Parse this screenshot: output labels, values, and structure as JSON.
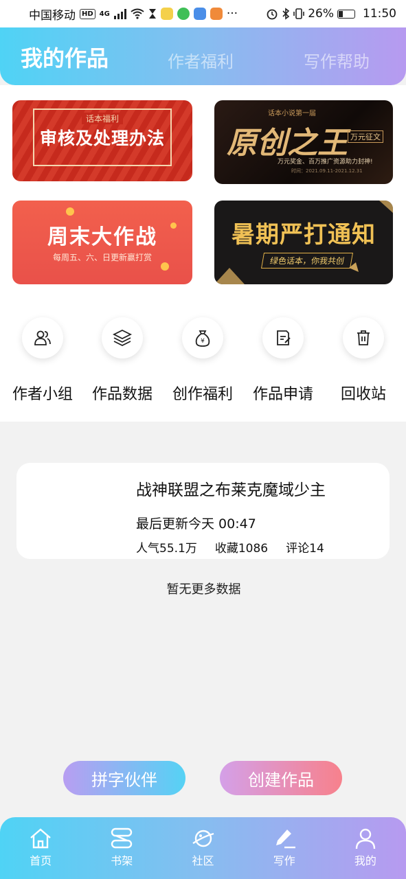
{
  "status_bar": {
    "carrier": "中国移动",
    "hd": "HD",
    "net": "4G",
    "battery": "26%",
    "time": "11:50",
    "more": "···"
  },
  "header": {
    "tabs": [
      {
        "label": "我的作品",
        "active": true
      },
      {
        "label": "作者福利",
        "active": false
      },
      {
        "label": "写作帮助",
        "active": false
      }
    ]
  },
  "banners": [
    {
      "small": "话本福利",
      "big": "审核及处理办法"
    },
    {
      "small": "话本小说第一届",
      "big": "原创之王",
      "tag": "万元征文",
      "sub": "万元奖金、百万推广资源助力封神!",
      "date": "时间：2021.09.11-2021.12.31"
    },
    {
      "big": "周末大作战",
      "sub": "每周五、六、日更新赢打赏"
    },
    {
      "big": "暑期严打通知",
      "sub": "绿色话本，你我共创"
    }
  ],
  "quick_actions": [
    {
      "label": "作者小组",
      "icon": "users-icon"
    },
    {
      "label": "作品数据",
      "icon": "layers-icon"
    },
    {
      "label": "创作福利",
      "icon": "money-bag-icon"
    },
    {
      "label": "作品申请",
      "icon": "document-edit-icon"
    },
    {
      "label": "回收站",
      "icon": "trash-icon"
    }
  ],
  "work": {
    "title": "战神联盟之布莱克魔域少主",
    "updated": "最后更新今天 00:47",
    "popularity": "人气55.1万",
    "favorites": "收藏1086",
    "comments": "评论14"
  },
  "no_more": "暂无更多数据",
  "actions": {
    "partner": "拼字伙伴",
    "create": "创建作品"
  },
  "bottom_nav": [
    {
      "label": "首页",
      "icon": "home-icon"
    },
    {
      "label": "书架",
      "icon": "bookshelf-icon"
    },
    {
      "label": "社区",
      "icon": "planet-icon"
    },
    {
      "label": "写作",
      "icon": "pen-icon"
    },
    {
      "label": "我的",
      "icon": "user-icon"
    }
  ],
  "colors": {
    "gradient_start": "#4fd3f5",
    "gradient_end": "#b79af0",
    "create_button": "#f7818c"
  }
}
